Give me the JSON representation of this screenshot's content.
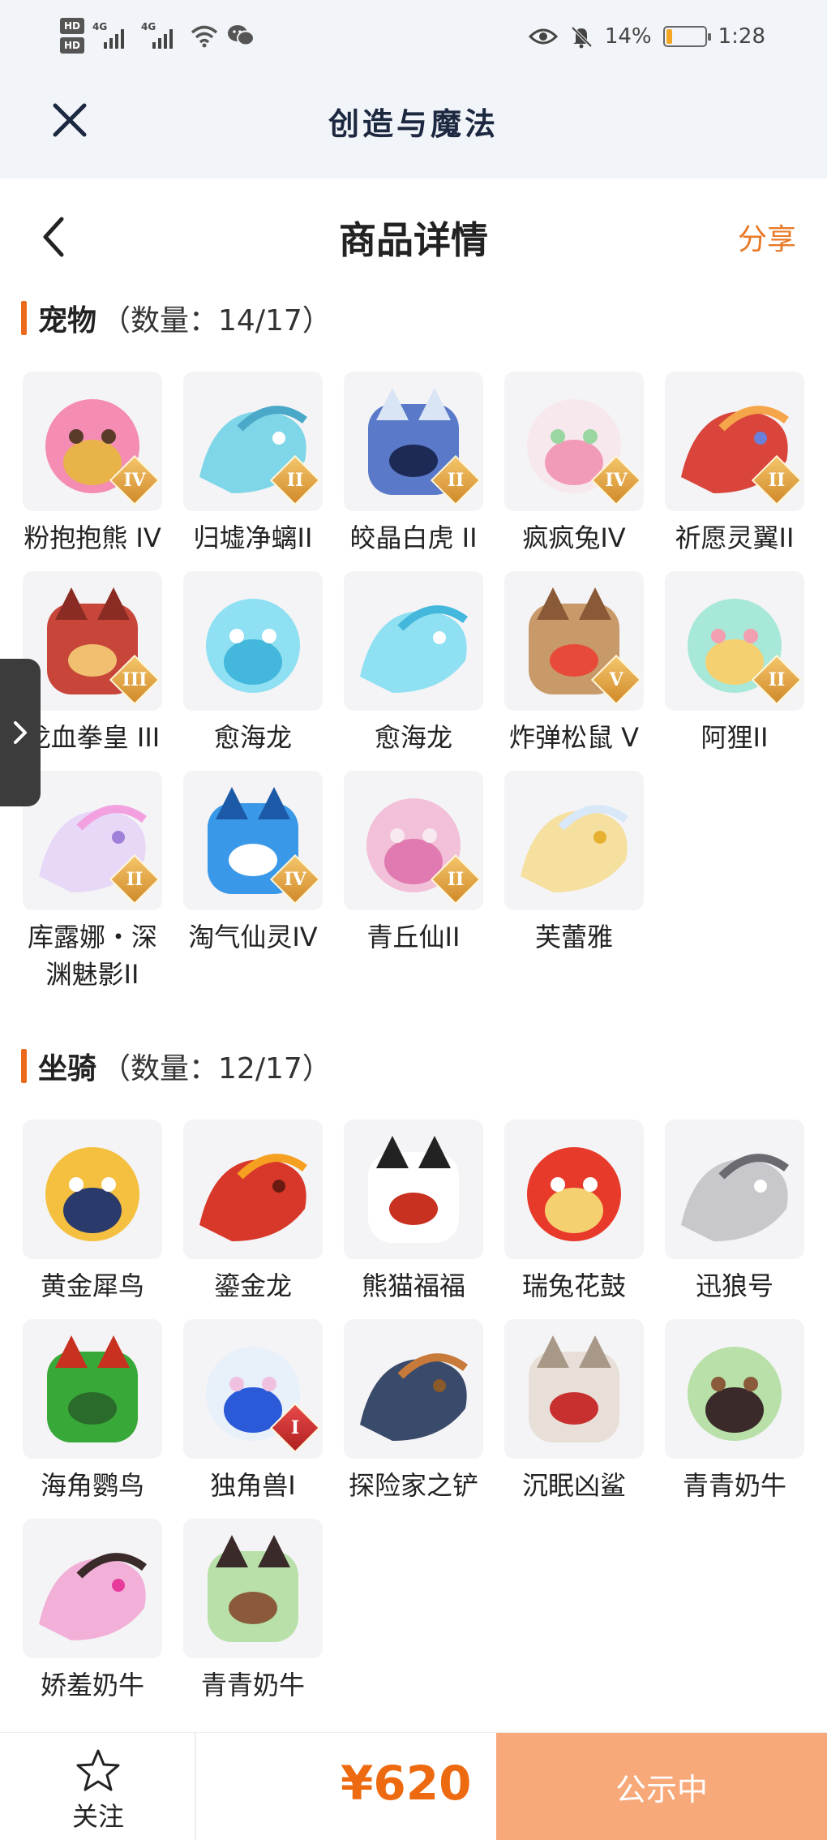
{
  "status_bar": {
    "hd1": "HD",
    "hd2": "HD",
    "net1": "4G",
    "net2": "4G",
    "battery_percent": "14%",
    "battery_level": 0.14,
    "time": "1:28",
    "icons": [
      "eye-icon",
      "mute-bell-icon",
      "wifi-icon",
      "wechat-icon"
    ]
  },
  "app": {
    "title": "创造与魔法"
  },
  "header": {
    "title": "商品详情",
    "share": "分享"
  },
  "pets": {
    "title": "宠物",
    "count": "（数量：14/17）",
    "items": [
      {
        "name": "粉抱抱熊 IV",
        "grade": "IV"
      },
      {
        "name": "归墟净螭II",
        "grade": "II"
      },
      {
        "name": "皎晶白虎 II",
        "grade": "II"
      },
      {
        "name": "疯疯兔IV",
        "grade": "IV"
      },
      {
        "name": "祈愿灵翼II",
        "grade": "II"
      },
      {
        "name": "龙血拳皇 III",
        "grade": "III"
      },
      {
        "name": "愈海龙",
        "grade": ""
      },
      {
        "name": "愈海龙",
        "grade": ""
      },
      {
        "name": "炸弹松鼠 V",
        "grade": "V"
      },
      {
        "name": "阿狸II",
        "grade": "II"
      },
      {
        "name": "库露娜・深渊魅影II",
        "grade": "II"
      },
      {
        "name": "淘气仙灵IV",
        "grade": "IV"
      },
      {
        "name": "青丘仙II",
        "grade": "II"
      },
      {
        "name": "芙蕾雅",
        "grade": ""
      }
    ]
  },
  "mounts": {
    "title": "坐骑",
    "count": "（数量：12/17）",
    "items": [
      {
        "name": "黄金犀鸟",
        "grade": ""
      },
      {
        "name": "鎏金龙",
        "grade": ""
      },
      {
        "name": "熊猫福福",
        "grade": ""
      },
      {
        "name": "瑞兔花鼓",
        "grade": ""
      },
      {
        "name": "迅狼号",
        "grade": ""
      },
      {
        "name": "海角鹦鸟",
        "grade": ""
      },
      {
        "name": "独角兽I",
        "grade": "I"
      },
      {
        "name": "探险家之铲",
        "grade": ""
      },
      {
        "name": "沉眠凶鲨",
        "grade": ""
      },
      {
        "name": "青青奶牛",
        "grade": ""
      },
      {
        "name": "娇羞奶牛",
        "grade": ""
      },
      {
        "name": "青青奶牛",
        "grade": ""
      }
    ]
  },
  "footer": {
    "follow": "关注",
    "price": "¥620",
    "status": "公示中"
  },
  "colors": {
    "accent": "#ec6a1c",
    "price": "#ee6a10",
    "status_button": "#f8a97a",
    "title_dark": "#1c2740"
  }
}
